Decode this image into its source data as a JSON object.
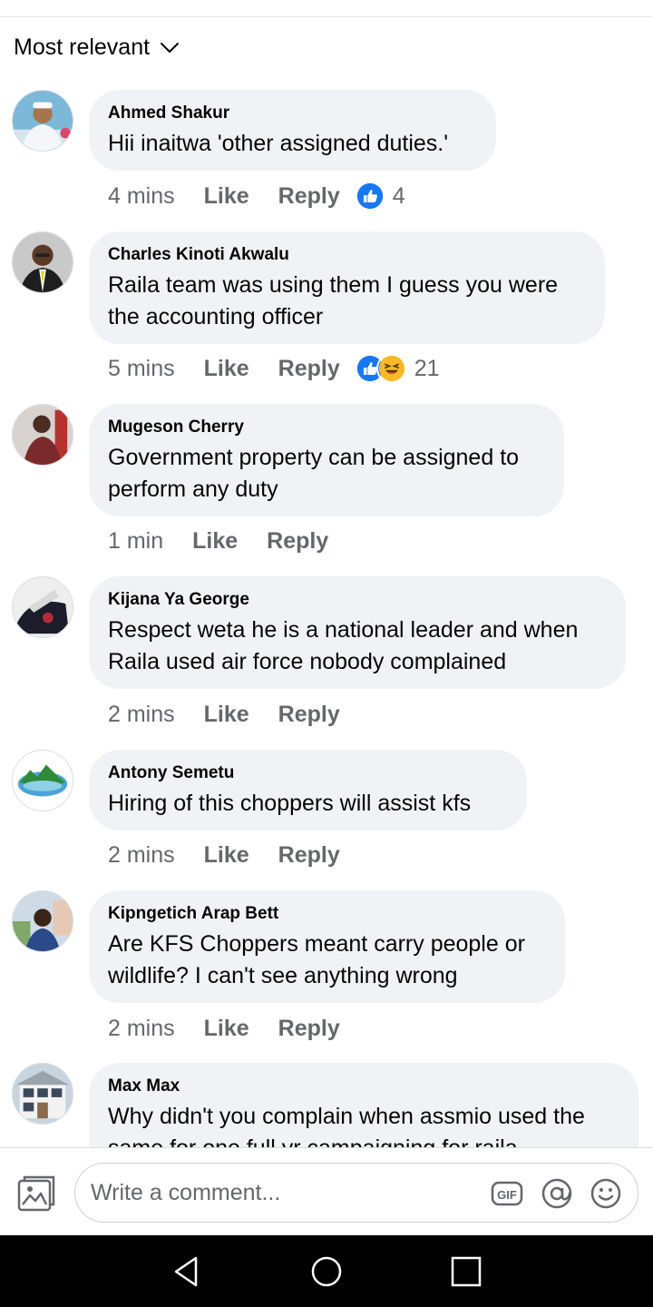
{
  "sort": {
    "label": "Most relevant"
  },
  "actions": {
    "like_label": "Like",
    "reply_label": "Reply"
  },
  "comments": [
    {
      "author": "Ahmed Shakur",
      "text": "Hii inaitwa 'other assigned duties.'",
      "time": "4 mins",
      "reactions": [
        "like"
      ],
      "reaction_count": "4"
    },
    {
      "author": "Charles Kinoti Akwalu",
      "text": "Raila team was using them I guess you were\nthe accounting officer",
      "time": "5 mins",
      "reactions": [
        "like",
        "haha"
      ],
      "reaction_count": "21"
    },
    {
      "author": "Mugeson Cherry",
      "text": "Government property can be assigned to\nperform any duty",
      "time": "1 min"
    },
    {
      "author": "Kijana Ya George",
      "text": "Respect weta he is a national leader and when\nRaila used air force nobody complained",
      "time": "2 mins"
    },
    {
      "author": "Antony Semetu",
      "text": "Hiring of this choppers will assist kfs",
      "time": "2 mins"
    },
    {
      "author": "Kipngetich Arap Bett",
      "text": "Are KFS Choppers meant carry people or\nwildlife? I can't see anything wrong",
      "time": "2 mins"
    },
    {
      "author": "Max Max",
      "text": "Why didn't you complain when assmio used the\nsame for one full yr campaigning for raila",
      "time": ""
    }
  ],
  "composer": {
    "placeholder": "Write a comment...",
    "icons": [
      "photo-icon",
      "gif-icon",
      "mention-icon",
      "emoji-icon"
    ]
  },
  "navigation": {
    "icons": [
      "back-icon",
      "home-icon",
      "recents-icon"
    ]
  },
  "colors": {
    "bubble": "#f0f2f5",
    "meta_text": "#65676b",
    "like_blue": "#1877f2",
    "haha_yellow": "#f7b928",
    "nav_bar": "#000000"
  }
}
